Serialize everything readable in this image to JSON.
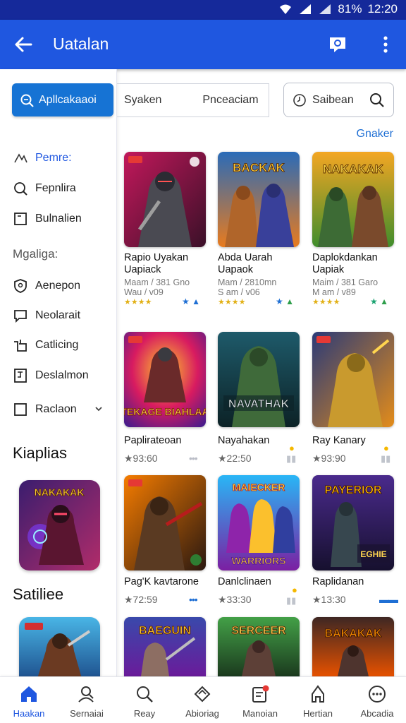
{
  "status_bar": {
    "battery_text": "81%",
    "time": "12:20"
  },
  "app_bar": {
    "title": "Uatalan"
  },
  "tabs": [
    {
      "label": "Syaken"
    },
    {
      "label": "Pnceaciam"
    }
  ],
  "search": {
    "placeholder": "Saibean"
  },
  "more_link": "Gnaker",
  "sidebar": {
    "apps_button": "Apllcakaaoi",
    "items": [
      {
        "label": "Pemre:",
        "icon": "sparkle-icon"
      },
      {
        "label": "Fepnlira",
        "icon": "search-icon"
      },
      {
        "label": "Bulnalien",
        "icon": "page-icon"
      }
    ],
    "sub_header": "Mgaliga:",
    "items2": [
      {
        "label": "Aenepon",
        "icon": "shield-icon"
      },
      {
        "label": "Neolarait",
        "icon": "chat-icon"
      },
      {
        "label": "Catlicing",
        "icon": "cart-icon"
      },
      {
        "label": "Deslalmon",
        "icon": "document-icon"
      },
      {
        "label": "Raclaon",
        "icon": "checkbox-icon"
      }
    ],
    "section1": "Kiaplias",
    "section2": "Satiliee"
  },
  "games": [
    {
      "name": "Rapio Uyakan",
      "name2": "Uapiack",
      "meta": "Maam / 381 Gno",
      "meta2": "Wau / v09"
    },
    {
      "name": "Abda Uarah",
      "name2": "Uapaok",
      "meta": "Mam / 2810mn",
      "meta2": "S am / v06"
    },
    {
      "name": "Daplokdankan",
      "name2": "Uapiak",
      "meta": "Maim / 381 Garo",
      "meta2": "M am / v89"
    },
    {
      "name": "Paplirateoan",
      "rating": "★93:60"
    },
    {
      "name": "Nayahakan",
      "rating": "★22:50"
    },
    {
      "name": "Ray Kanary",
      "rating": "★93:90"
    },
    {
      "name": "Pag'K kavtarone",
      "rating": "★72:59"
    },
    {
      "name": "Danlclinaen",
      "rating": "★33:30"
    },
    {
      "name": "Raplidanan",
      "rating": "★13:30"
    }
  ],
  "card_titles": {
    "g2": "BACKAK",
    "g3": "NAKAKAK",
    "g4": "TEKAGE BIAHLAA",
    "g5": "NAVATHAK",
    "g7": "MAIECKER",
    "g8": "PAYERIOR",
    "g9": "BAEGUIN",
    "g10": "SERCEER",
    "g11": "BAKAKAK",
    "feat1": "NAKAKAK"
  },
  "bottom_nav": [
    {
      "label": "Haakan",
      "icon": "home-icon"
    },
    {
      "label": "Sernaiai",
      "icon": "user-search-icon"
    },
    {
      "label": "Reay",
      "icon": "search-icon"
    },
    {
      "label": "Abioriag",
      "icon": "ticket-icon"
    },
    {
      "label": "Manoian",
      "icon": "notification-box-icon"
    },
    {
      "label": "Hertian",
      "icon": "person-icon"
    },
    {
      "label": "Abcadia",
      "icon": "more-circle-icon"
    }
  ],
  "colors": {
    "primary": "#1f57e0",
    "status_bar": "#15299a",
    "accent_button": "#1673d4",
    "link": "#1f6fd4"
  }
}
